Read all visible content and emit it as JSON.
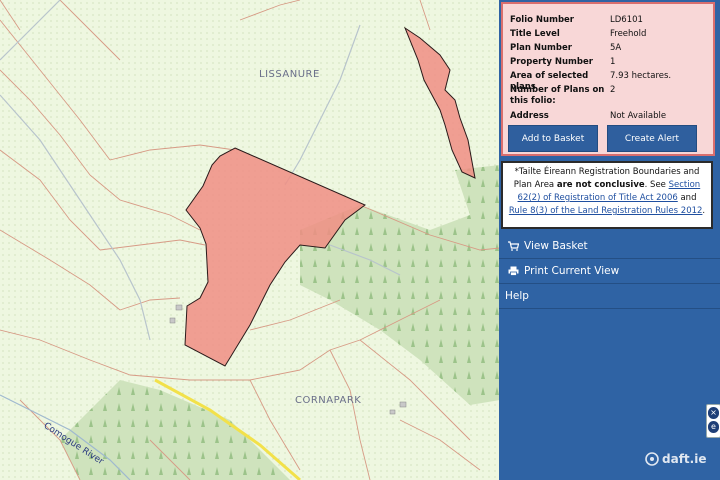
{
  "map": {
    "labels": {
      "lissanure": "LISSANURE",
      "cornapark": "CORNAPARK",
      "river": "Comogue River"
    }
  },
  "panel": {
    "info": [
      {
        "key": "Folio Number",
        "value": "LD6101"
      },
      {
        "key": "Title Level",
        "value": "Freehold"
      },
      {
        "key": "Plan Number",
        "value": "5A"
      },
      {
        "key": "Property Number",
        "value": "1"
      },
      {
        "key": "Area of selected plans",
        "value": "7.93 hectares."
      },
      {
        "key": "Number of Plans on this folio:",
        "value": "2"
      },
      {
        "key": "Address",
        "value": "Not Available"
      }
    ],
    "buttons": {
      "add_to_basket": "Add to Basket",
      "create_alert": "Create Alert"
    },
    "note": {
      "prefix": "*Tailte Éireann Registration Boundaries and Plan Area ",
      "bold": "are not conclusive",
      "mid1": ". See ",
      "link1": "Section 62(2) of Registration of Title Act 2006",
      "mid2": " and ",
      "link2": "Rule 8(3) of the Land Registration Rules 2012",
      "end": "."
    },
    "menu": {
      "view_basket": "View Basket",
      "print_view": "Print Current View",
      "help": "Help"
    },
    "tools": {
      "close": "×",
      "info": "e"
    }
  },
  "watermark": "daft.ie",
  "colors": {
    "panel": "#2f63a4",
    "parcel": "#f08e84",
    "forest": "#cfe3bd",
    "map_bg": "#eef7e0"
  }
}
